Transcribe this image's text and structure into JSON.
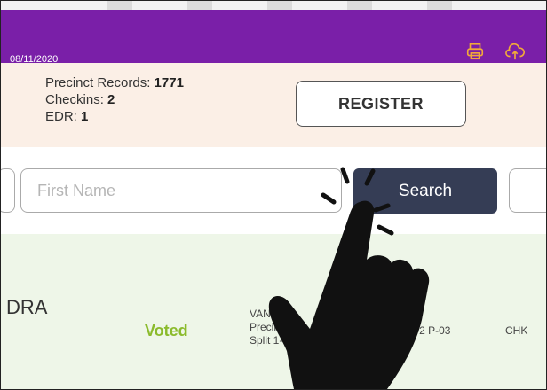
{
  "header": {
    "date": "08/11/2020",
    "icons": [
      "printer-icon",
      "cloud-upload-icon"
    ],
    "color": "#7a1fa8"
  },
  "stats": {
    "records_label": "Precinct Records:",
    "records_value": "1771",
    "checkins_label": "Checkins:",
    "checkins_value": "2",
    "edr_label": "EDR:",
    "edr_value": "1"
  },
  "register_label": "REGISTER",
  "search": {
    "first_name_placeholder": "First Name",
    "button_label": "Search",
    "button_color": "#353d55"
  },
  "result": {
    "name": "DRA",
    "status": "Voted",
    "status_color": "#8bbb2c",
    "info_line1": "VAN C",
    "info_line2": "Precinc",
    "info_line3": "Split 1-",
    "ward": "W-2 P-03",
    "checkin": "CHK"
  }
}
